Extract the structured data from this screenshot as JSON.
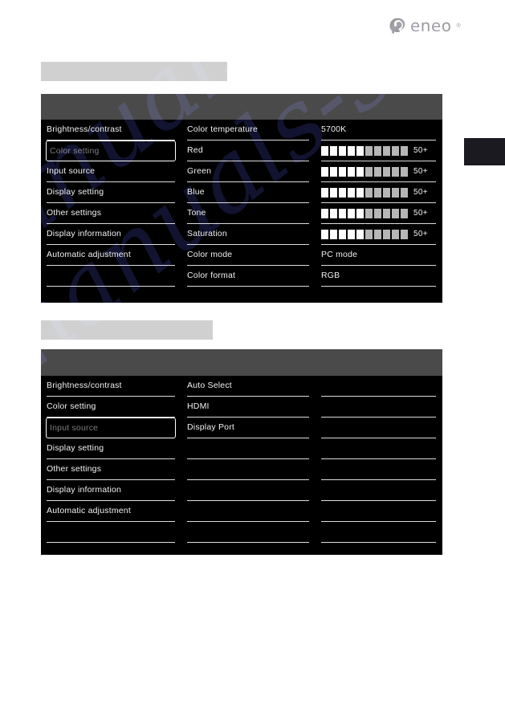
{
  "brand": {
    "name": "eneo",
    "trademark": "®",
    "logo_icon": "eneo-camera-logo-icon",
    "color": "#9b9b9b"
  },
  "captions": {
    "caption_1": "",
    "caption_2": "",
    "color": "#d0d0d0"
  },
  "watermark": {
    "line1": "manualshive",
    "line2": "manuals-search"
  },
  "colors": {
    "panel_background": "#000000",
    "panel_titlebar": "#4a4a4a",
    "row_divider": "#dcdcdc",
    "row_text": "#f2f2f2",
    "selected_row_text": "#7c7c7c",
    "selected_row_border": "#ffffff",
    "segment_on": "#ffffff",
    "segment_off": "#b6b6b6",
    "edge_tab": "#1a1a20"
  },
  "panel_1": {
    "title": "",
    "left_column": [
      {
        "label": "Brightness/contrast",
        "selected": false
      },
      {
        "label": "Color setting",
        "selected": true
      },
      {
        "label": "Input source",
        "selected": false
      },
      {
        "label": "Display setting",
        "selected": false
      },
      {
        "label": "Other settings",
        "selected": false
      },
      {
        "label": "Display information",
        "selected": false
      },
      {
        "label": "Automatic adjustment",
        "selected": false
      },
      {
        "label": "",
        "selected": false
      }
    ],
    "middle_column": [
      {
        "label": "Color temperature"
      },
      {
        "label": "Red"
      },
      {
        "label": "Green"
      },
      {
        "label": "Blue"
      },
      {
        "label": "Tone"
      },
      {
        "label": "Saturation"
      },
      {
        "label": "Color mode"
      },
      {
        "label": "Color format"
      }
    ],
    "right_column": [
      {
        "type": "text",
        "label": "5700K"
      },
      {
        "type": "bar",
        "label": "50+",
        "segments_on": 5,
        "segments_total": 10
      },
      {
        "type": "bar",
        "label": "50+",
        "segments_on": 5,
        "segments_total": 10
      },
      {
        "type": "bar",
        "label": "50+",
        "segments_on": 5,
        "segments_total": 10
      },
      {
        "type": "bar",
        "label": "50+",
        "segments_on": 5,
        "segments_total": 10
      },
      {
        "type": "bar",
        "label": "50+",
        "segments_on": 5,
        "segments_total": 10
      },
      {
        "type": "text",
        "label": "PC mode"
      },
      {
        "type": "text",
        "label": "RGB"
      }
    ]
  },
  "panel_2": {
    "title": "",
    "left_column": [
      {
        "label": "Brightness/contrast",
        "selected": false
      },
      {
        "label": "Color setting",
        "selected": false
      },
      {
        "label": "Input source",
        "selected": true
      },
      {
        "label": "Display setting",
        "selected": false
      },
      {
        "label": "Other settings",
        "selected": false
      },
      {
        "label": "Display information",
        "selected": false
      },
      {
        "label": "Automatic adjustment",
        "selected": false
      },
      {
        "label": "",
        "selected": false
      }
    ],
    "middle_column": [
      {
        "label": "Auto Select"
      },
      {
        "label": "HDMI"
      },
      {
        "label": "Display Port"
      },
      {
        "label": ""
      },
      {
        "label": ""
      },
      {
        "label": ""
      },
      {
        "label": ""
      },
      {
        "label": ""
      }
    ],
    "right_column": [
      {
        "type": "text",
        "label": ""
      },
      {
        "type": "text",
        "label": ""
      },
      {
        "type": "text",
        "label": ""
      },
      {
        "type": "text",
        "label": ""
      },
      {
        "type": "text",
        "label": ""
      },
      {
        "type": "text",
        "label": ""
      },
      {
        "type": "text",
        "label": ""
      },
      {
        "type": "text",
        "label": ""
      }
    ]
  }
}
